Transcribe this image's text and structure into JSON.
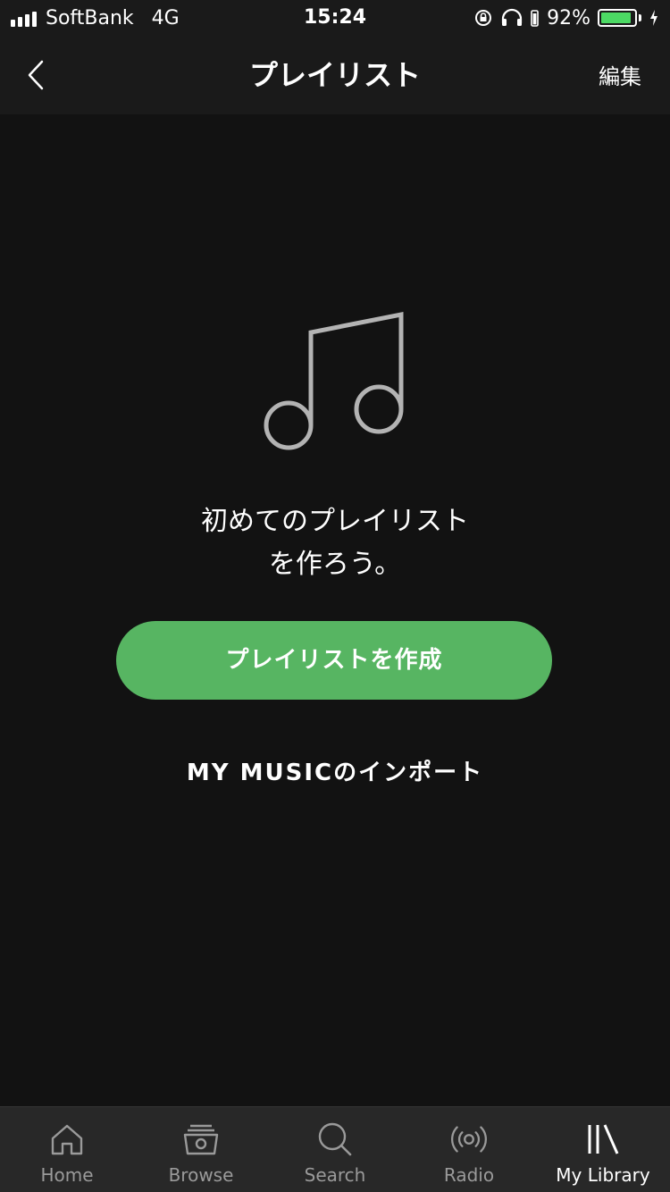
{
  "status_bar": {
    "carrier": "SoftBank",
    "network": "4G",
    "time": "15:24",
    "battery_percent": "92%",
    "battery_level": 0.92,
    "icons": [
      "signal-bars-icon",
      "orientation-lock-icon",
      "headphones-icon",
      "battery-icon",
      "charging-bolt-icon"
    ]
  },
  "nav": {
    "back_icon": "chevron-left-icon",
    "title": "プレイリスト",
    "edit_label": "編集"
  },
  "empty_state": {
    "icon": "music-note-icon",
    "message_line1": "初めてのプレイリスト",
    "message_line2": "を作ろう。",
    "create_button_label": "プレイリストを作成",
    "import_label": "MY MUSICのインポート"
  },
  "colors": {
    "background": "#121212",
    "bar_background": "#1a1a1a",
    "accent_green": "#57b562",
    "tab_bar_background": "#282828",
    "inactive_tab": "#9a9a9a",
    "active_tab": "#ffffff"
  },
  "tab_bar": {
    "tabs": [
      {
        "label": "Home",
        "icon": "home-icon",
        "active": false
      },
      {
        "label": "Browse",
        "icon": "browse-icon",
        "active": false
      },
      {
        "label": "Search",
        "icon": "search-icon",
        "active": false
      },
      {
        "label": "Radio",
        "icon": "radio-icon",
        "active": false
      },
      {
        "label": "My Library",
        "icon": "library-icon",
        "active": true
      }
    ]
  }
}
